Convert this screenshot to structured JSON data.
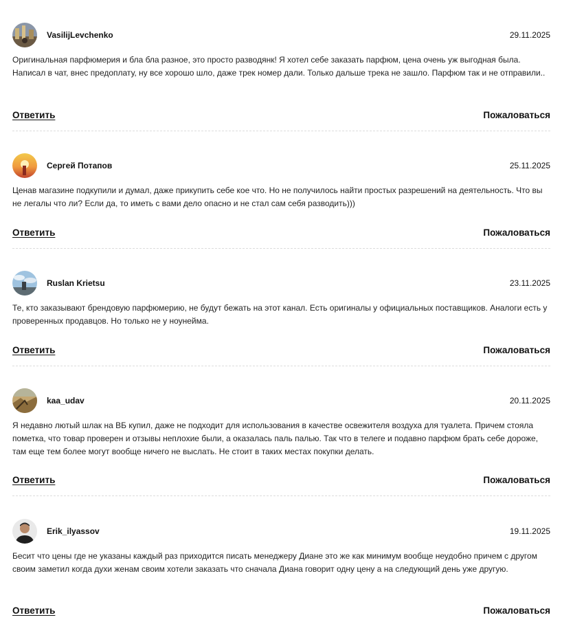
{
  "actions": {
    "reply_label": "Ответить",
    "report_label": "Пожаловаться"
  },
  "comments": [
    {
      "author": "VasilijLevchenko",
      "date": "29.11.2025",
      "text": "Оригинальная парфюмерия и бла бла разное, это просто разводянк! Я хотел себе заказать парфюм, цена очень уж выгодная была. Написал в чат, внес предоплату, ну все хорошо шло, даже трек номер дали. Только дальше трека не зашло. Парфюм так и не отправили..",
      "avatar": "street-photo"
    },
    {
      "author": "Сергей Потапов",
      "date": "25.11.2025",
      "text": "Ценав магазине подкупили и думал, даже прикупить себе кое что. Но не получилось найти простых разрешений на деятельность. Что вы не легалы что ли? Если да, то иметь с вами дело опасно и не стал сам себя разводить)))",
      "avatar": "sunset-photo"
    },
    {
      "author": "Ruslan Krietsu",
      "date": "23.11.2025",
      "text": "Те, кто заказывают брендовую парфюмерию, не будут бежать на этот канал. Есть оригиналы у официальных поставщиков. Аналоги есть у проверенных продавцов. Но только не у ноунейма.",
      "avatar": "sky-photo"
    },
    {
      "author": "kaa_udav",
      "date": "20.11.2025",
      "text": "Я недавно лютый шлак на ВБ купил, даже не подходит для использования в качестве освежителя воздуха для туалета. Причем стояла пометка, что товар проверен и отзывы неплохие были, а оказалась паль палью. Так что в телеге и подавно парфюм брать себе дороже, там еще тем более могут вообще ничего не выслать. Не стоит в таких местах покупки делать.",
      "avatar": "field-photo"
    },
    {
      "author": "Erik_ilyassov",
      "date": "19.11.2025",
      "text": "Бесит что цены где не указаны каждый раз приходится писать менеджеру Диане это же как минимум вообще неудобно причем с другом своим заметил когда духи женам своим хотели заказать что сначала Диана говорит одну цену а на следующий день уже другую.",
      "avatar": "portrait-photo"
    }
  ]
}
